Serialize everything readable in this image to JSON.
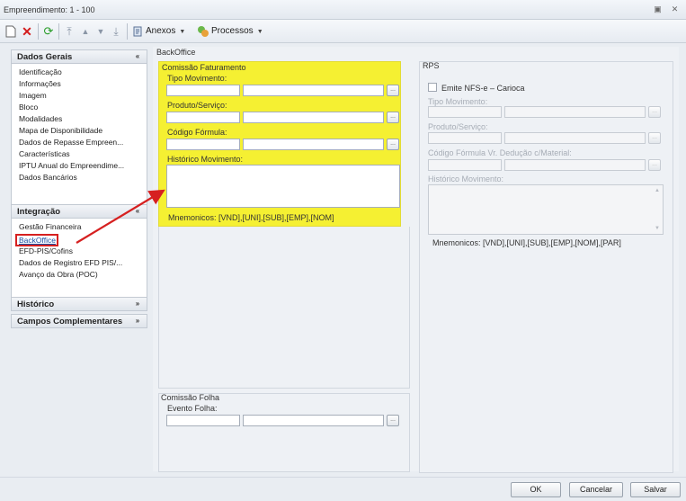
{
  "window": {
    "title": "Empreendimento: 1 - 100"
  },
  "toolbar": {
    "anexos_label": "Anexos",
    "processos_label": "Processos"
  },
  "sidebar": {
    "dados_gerais": {
      "title": "Dados Gerais",
      "items": [
        "Identificação",
        "Informações",
        "Imagem",
        "Bloco",
        "Modalidades",
        "Mapa de Disponibilidade",
        "Dados de Repasse Empreen...",
        "Características",
        "IPTU Anual do Empreendime...",
        "Dados Bancários"
      ]
    },
    "integracao": {
      "title": "Integração",
      "items": [
        "Gestão Financeira",
        "BackOffice",
        "EFD-PIS/Cofins",
        "Dados de Registro EFD PIS/...",
        "Avanço da Obra (POC)"
      ]
    },
    "historico": {
      "title": "Histórico"
    },
    "campos": {
      "title": "Campos Complementares"
    }
  },
  "main": {
    "section_title": "BackOffice",
    "comissao": {
      "title": "Comissão Faturamento",
      "tipo_movimento": "Tipo Movimento:",
      "produto_servico": "Produto/Serviço:",
      "codigo_formula": "Código Fórmula:",
      "historico_movimento": "Histórico Movimento:",
      "mnemonicos": "Mnemonicos: [VND],[UNI],[SUB],[EMP],[NOM]"
    },
    "rps": {
      "title": "RPS",
      "emite_label": "Emite NFS-e – Carioca",
      "tipo_movimento": "Tipo Movimento:",
      "produto_servico": "Produto/Serviço:",
      "codigo_formula": "Código Fórmula Vr. Dedução c/Material:",
      "historico_movimento": "Histórico Movimento:",
      "mnemonicos": "Mnemonicos: [VND],[UNI],[SUB],[EMP],[NOM],[PAR]"
    },
    "folha": {
      "title": "Comissão Folha",
      "evento_folha": "Evento Folha:"
    },
    "lookup_glyph": "..."
  },
  "footer": {
    "ok_label": "OK",
    "cancelar_label": "Cancelar",
    "salvar_label": "Salvar"
  },
  "colors": {
    "highlight": "#f5f032",
    "annotation": "#d62020",
    "link": "#1a4fa3"
  }
}
